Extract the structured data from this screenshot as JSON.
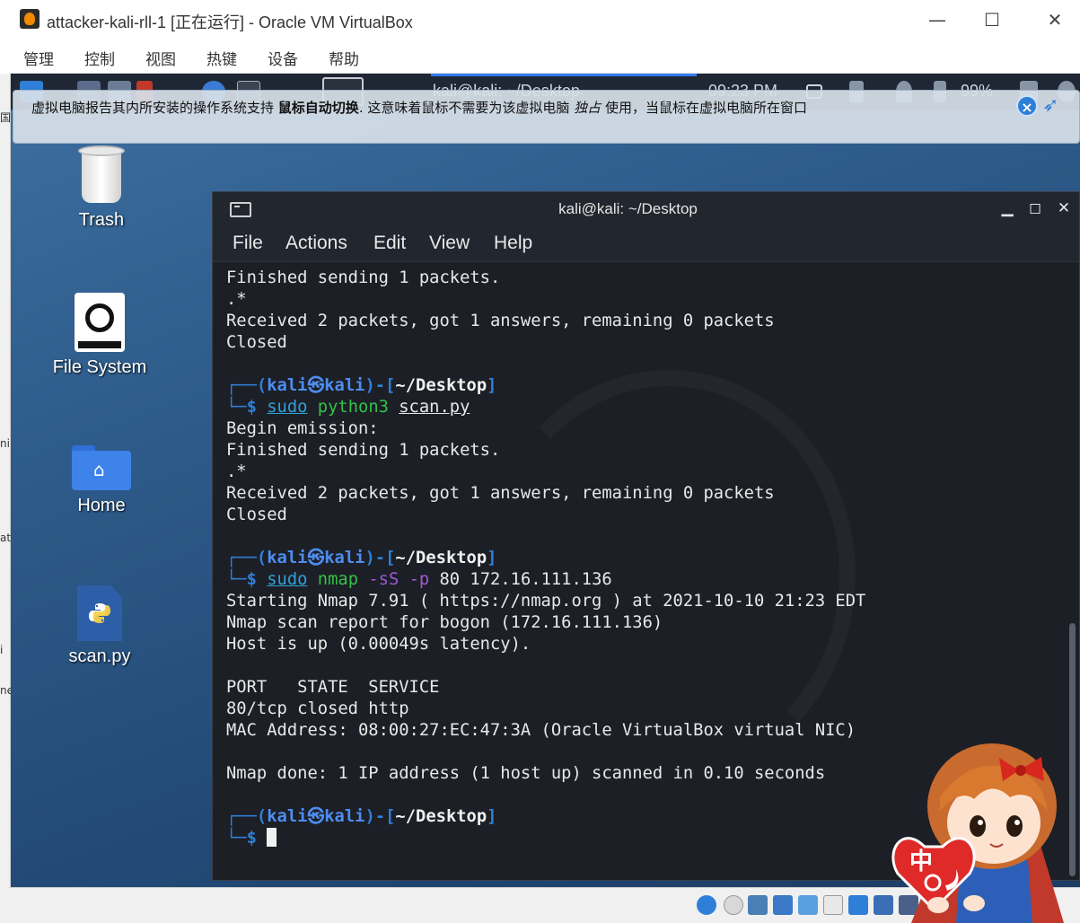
{
  "host": {
    "title": "attacker-kali-rll-1 [正在运行] - Oracle VM VirtualBox",
    "menu": [
      "管理",
      "控制",
      "视图",
      "热键",
      "设备",
      "帮助"
    ],
    "left_strip": [
      "国",
      "ni",
      "at",
      "i",
      "ne"
    ]
  },
  "guest_panel": {
    "task_label": "kali@kali: ~/Desktop",
    "clock": "09:23 PM",
    "battery": "99%"
  },
  "notification": {
    "prefix": "虚拟电脑报告其内所安装的操作系统支持",
    "bold": "鼠标自动切换",
    "middle": ". 这意味着鼠标不需要为该虚拟电脑",
    "italic": "独占",
    "suffix": "使用，当鼠标在虚拟电脑所在窗口"
  },
  "desktop": {
    "icons": [
      {
        "label": "Trash"
      },
      {
        "label": "File System"
      },
      {
        "label": "Home"
      },
      {
        "label": "scan.py"
      }
    ]
  },
  "terminal": {
    "title": "kali@kali: ~/Desktop",
    "menu": [
      "File",
      "Actions",
      "Edit",
      "View",
      "Help"
    ],
    "prompt_user": "kali",
    "prompt_at": "㉿",
    "prompt_host": "kali",
    "prompt_cwd": "~/Desktop",
    "lines": {
      "l1": "Finished sending 1 packets.",
      "l2": ".*",
      "l3": "Received 2 packets, got 1 answers, remaining 0 packets",
      "l4": "Closed",
      "cmd1_sudo": "sudo",
      "cmd1_prog": "python3",
      "cmd1_arg": "scan.py",
      "l5": "Begin emission:",
      "l6": "Finished sending 1 packets.",
      "l7": ".*",
      "l8": "Received 2 packets, got 1 answers, remaining 0 packets",
      "l9": "Closed",
      "cmd2_sudo": "sudo",
      "cmd2_prog": "nmap",
      "cmd2_opt1": "-sS",
      "cmd2_opt2": "-p",
      "cmd2_args": "80 172.16.111.136",
      "l10": "Starting Nmap 7.91 ( https://nmap.org ) at 2021-10-10 21:23 EDT",
      "l11": "Nmap scan report for bogon (172.16.111.136)",
      "l12": "Host is up (0.00049s latency).",
      "l13": "PORT   STATE  SERVICE",
      "l14": "80/tcp closed http",
      "l15": "MAC Address: 08:00:27:EC:47:3A (Oracle VirtualBox virtual NIC)",
      "l16": "Nmap done: 1 IP address (1 host up) scanned in 0.10 seconds"
    }
  },
  "mascot": {
    "badge_text": "中"
  },
  "colors": {
    "prompt_blue": "#2f7fd8",
    "command_green": "#34c14a",
    "option_purple": "#a05ad8",
    "terminal_bg": "#1c1f26"
  }
}
